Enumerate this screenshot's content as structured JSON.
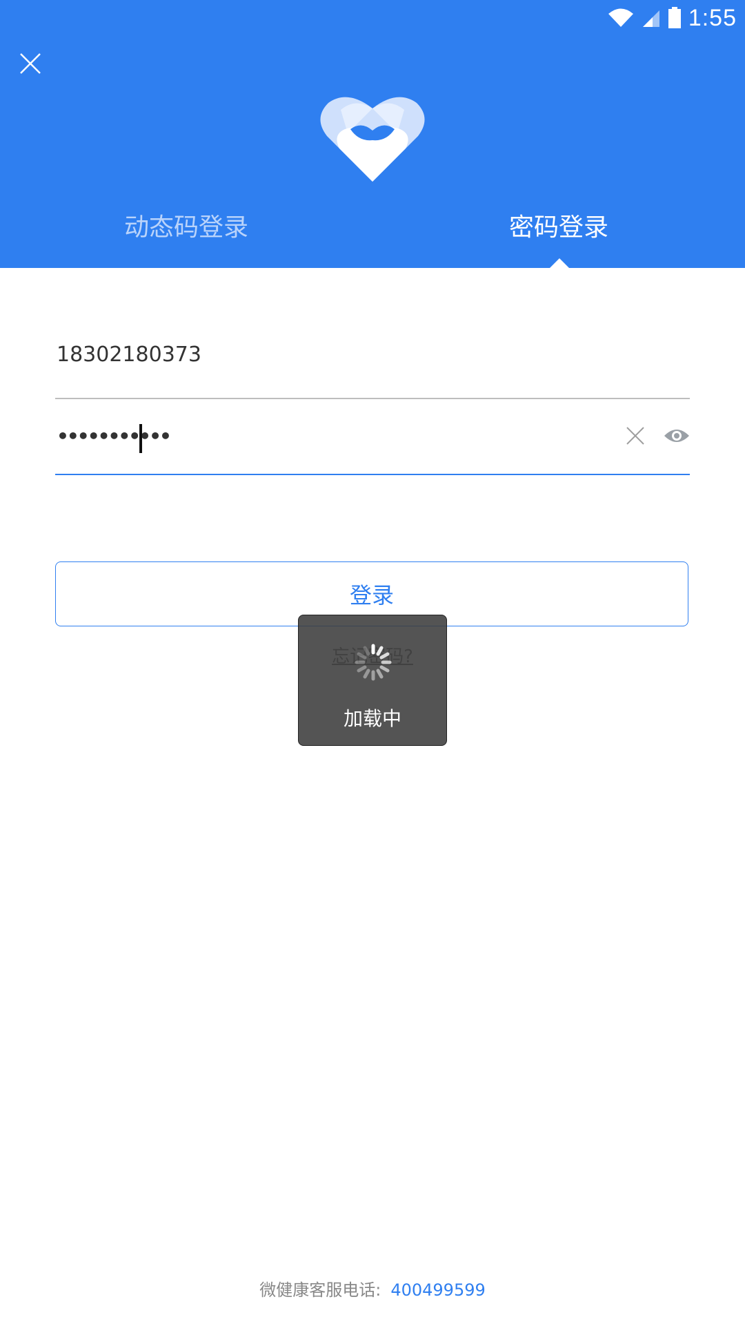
{
  "status_bar": {
    "time": "1:55"
  },
  "header": {
    "tabs": [
      {
        "label": "动态码登录",
        "active": false
      },
      {
        "label": "密码登录",
        "active": true
      }
    ]
  },
  "form": {
    "phone_value": "18302180373",
    "password_value": "•••••••••••",
    "login_label": "登录",
    "forgot_label": "忘记密码?"
  },
  "loading": {
    "text": "加载中"
  },
  "footer": {
    "label": "微健康客服电话:",
    "phone": "400499599"
  },
  "colors": {
    "primary": "#2f7ff0",
    "overlay": "#3c3c3c"
  },
  "icons": [
    "close-icon",
    "heart-logo-icon",
    "wifi-icon",
    "signal-icon",
    "battery-icon",
    "clear-icon",
    "eye-icon",
    "spinner-icon"
  ]
}
